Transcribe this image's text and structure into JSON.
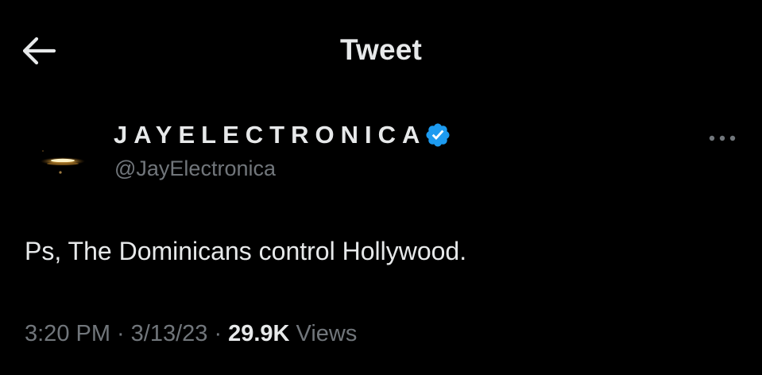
{
  "header": {
    "title": "Tweet",
    "back_icon": "arrow-left-icon"
  },
  "author": {
    "display_name": "JAYELECTRONICA",
    "handle": "@JayElectronica",
    "verified": true,
    "verified_color": "#1d9bf0",
    "more_icon": "more-horizontal-icon"
  },
  "tweet": {
    "text": "Ps, The Dominicans control Hollywood."
  },
  "meta": {
    "time": "3:20 PM",
    "separator": "·",
    "date": "3/13/23",
    "views_count": "29.9K",
    "views_label": "Views"
  },
  "colors": {
    "background": "#000000",
    "primary_text": "#e7e9ea",
    "secondary_text": "#71767b",
    "accent": "#1d9bf0"
  }
}
